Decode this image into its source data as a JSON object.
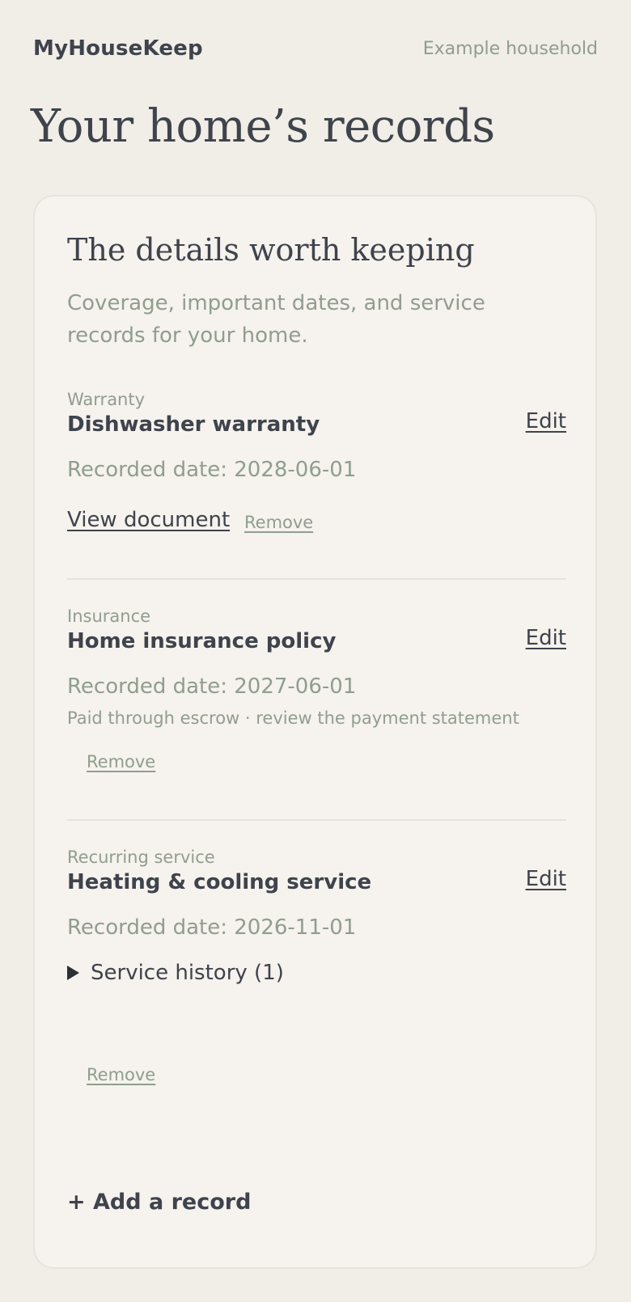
{
  "header": {
    "brand": "MyHouseKeep",
    "household": "Example household"
  },
  "page_title": "Your home’s records",
  "card": {
    "title": "The details worth keeping",
    "subtitle": "Coverage, important dates, and service records for your home."
  },
  "records": [
    {
      "category": "Warranty",
      "title": "Dishwasher warranty",
      "edit_label": "Edit",
      "date": "Recorded date: 2028-06-01",
      "view_document_label": "View document",
      "remove_label": "Remove"
    },
    {
      "category": "Insurance",
      "title": "Home insurance policy",
      "edit_label": "Edit",
      "date": "Recorded date: 2027-06-01",
      "note": "Paid through escrow · review the payment statement",
      "remove_label": "Remove"
    },
    {
      "category": "Recurring service",
      "title": "Heating & cooling service",
      "edit_label": "Edit",
      "date": "Recorded date: 2026-11-01",
      "history_label": "Service history (1)",
      "remove_label": "Remove"
    }
  ],
  "add_record_label": "+ Add a record",
  "icons": {
    "disclosure": "disclosure-triangle-icon"
  }
}
